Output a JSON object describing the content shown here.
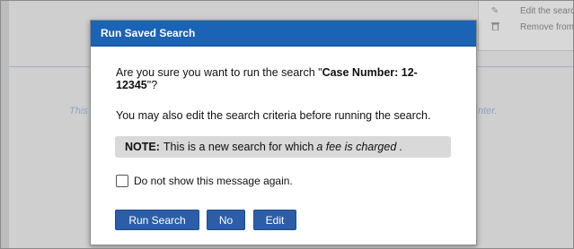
{
  "background": {
    "menu_items": [
      {
        "icon": "edit-icon",
        "glyph": "✎",
        "label": "Edit the searc"
      },
      {
        "icon": "trash-icon",
        "glyph": "🗑",
        "label": "Remove from"
      }
    ],
    "italic_left": "This",
    "italic_right": "nter."
  },
  "modal": {
    "title": "Run Saved Search",
    "question_prefix": "Are you sure you want to run the search \"",
    "search_name": "Case Number: 12-12345",
    "question_suffix": "\"?",
    "edit_text": "You may also edit the search criteria before running the search.",
    "note_label": "NOTE:",
    "note_text": "This is a new search for which",
    "note_emphasis": "a fee is charged",
    "note_end": ".",
    "checkbox_label": "Do not show this message again.",
    "checkbox_checked": false,
    "buttons": {
      "run": "Run Search",
      "no": "No",
      "edit": "Edit"
    }
  },
  "colors": {
    "header_blue": "#1a63b5",
    "button_blue": "#2b5ea7"
  }
}
